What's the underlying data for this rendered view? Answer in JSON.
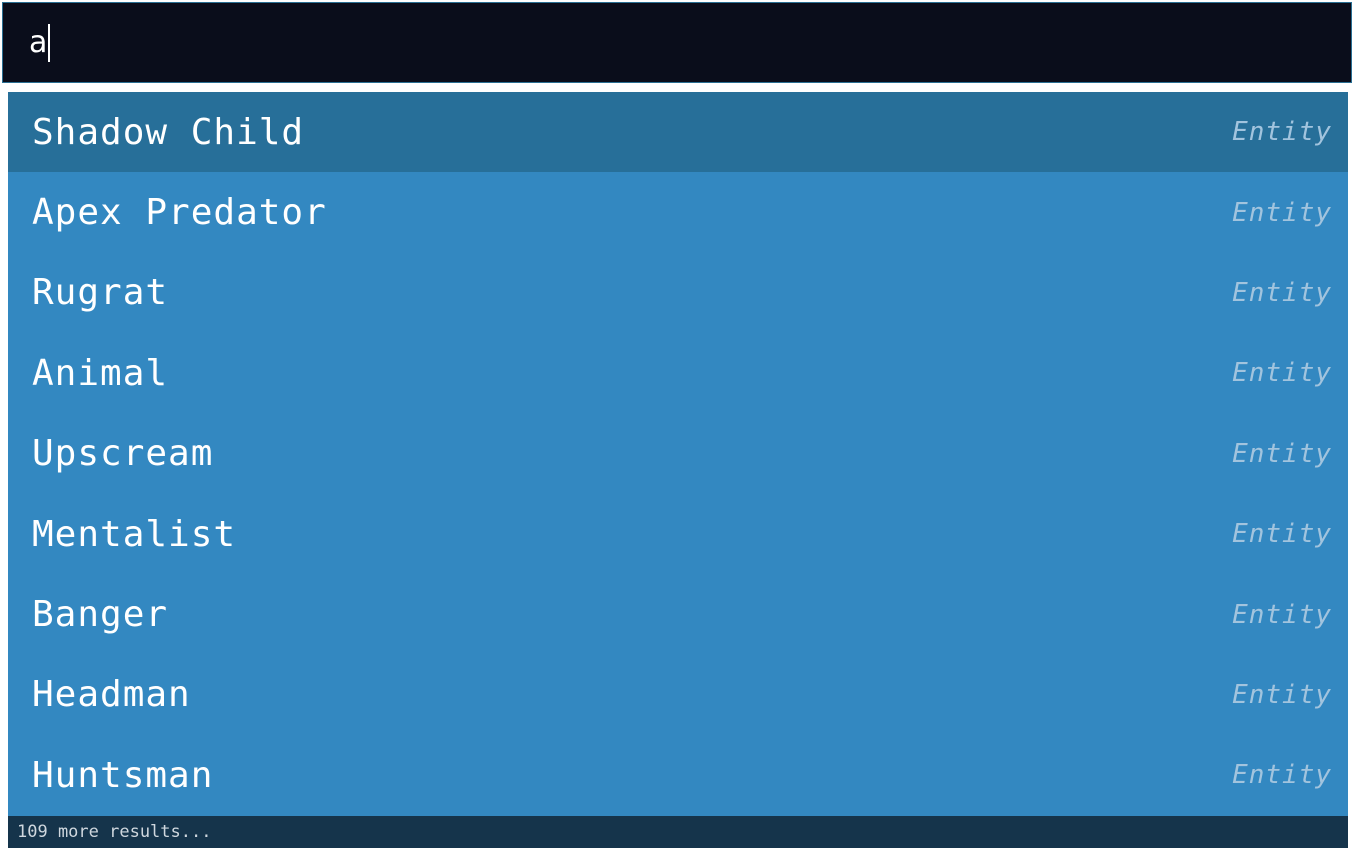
{
  "search": {
    "value": "a"
  },
  "results": [
    {
      "label": "Shadow Child",
      "type": "Entity",
      "selected": true
    },
    {
      "label": "Apex Predator",
      "type": "Entity",
      "selected": false
    },
    {
      "label": "Rugrat",
      "type": "Entity",
      "selected": false
    },
    {
      "label": "Animal",
      "type": "Entity",
      "selected": false
    },
    {
      "label": "Upscream",
      "type": "Entity",
      "selected": false
    },
    {
      "label": "Mentalist",
      "type": "Entity",
      "selected": false
    },
    {
      "label": "Banger",
      "type": "Entity",
      "selected": false
    },
    {
      "label": "Headman",
      "type": "Entity",
      "selected": false
    },
    {
      "label": "Huntsman",
      "type": "Entity",
      "selected": false
    }
  ],
  "footer": {
    "more_results": "109 more results..."
  },
  "colors": {
    "search_background": "#0a0d1b",
    "list_background": "#3388c1",
    "selected_background": "#276f99",
    "footer_background": "#15344b",
    "type_text": "#a2c4de"
  }
}
